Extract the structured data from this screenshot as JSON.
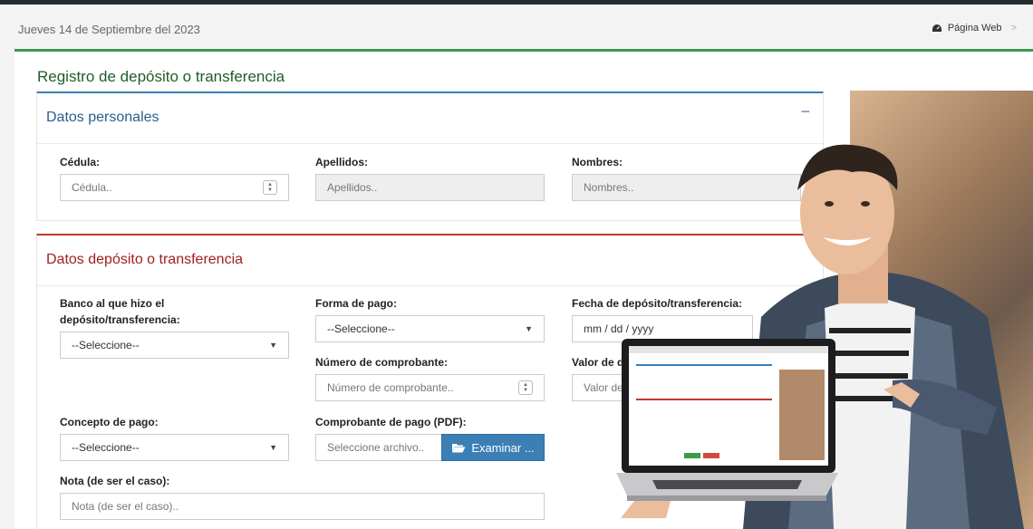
{
  "header": {
    "date": "Jueves 14 de Septiembre del 2023",
    "web_link": "Página Web",
    "chevron": ">"
  },
  "page": {
    "title": "Registro de depósito o transferencia"
  },
  "personal": {
    "title": "Datos personales",
    "collapse": "−",
    "cedula_label": "Cédula:",
    "cedula_placeholder": "Cédula..",
    "apellidos_label": "Apellidos:",
    "apellidos_placeholder": "Apellidos..",
    "nombres_label": "Nombres:",
    "nombres_placeholder": "Nombres.."
  },
  "deposit": {
    "title": "Datos depósito o transferencia",
    "banco_label_1": "Banco al que hizo el",
    "banco_label_2": "depósito/transferencia:",
    "banco_value": "--Seleccione--",
    "forma_label": "Forma de pago:",
    "forma_value": "--Seleccione--",
    "fecha_label": "Fecha de depósito/transferencia:",
    "fecha_value": "mm / dd / yyyy",
    "numero_label": "Número de comprobante:",
    "numero_placeholder": "Número de comprobante..",
    "valor_label": "Valor de d",
    "valor_placeholder": "Valor de",
    "concepto_label": "Concepto de pago:",
    "concepto_value": "--Seleccione--",
    "comprobante_label": "Comprobante de pago (PDF):",
    "comprobante_placeholder": "Seleccione archivo..",
    "browse_label": "Examinar ...",
    "nota_label": "Nota (de ser el caso):",
    "nota_placeholder": "Nota (de ser el caso).."
  },
  "colors": {
    "accent_green": "#3c9a4d",
    "personal_border": "#3a7fb8",
    "deposit_border": "#c0392b",
    "browse_button": "#3c7fb5"
  },
  "icons": {
    "dashboard": "dashboard-icon",
    "folder": "folder-open-icon",
    "spinner": "spinner-icon",
    "caret": "chevron-down-icon"
  }
}
